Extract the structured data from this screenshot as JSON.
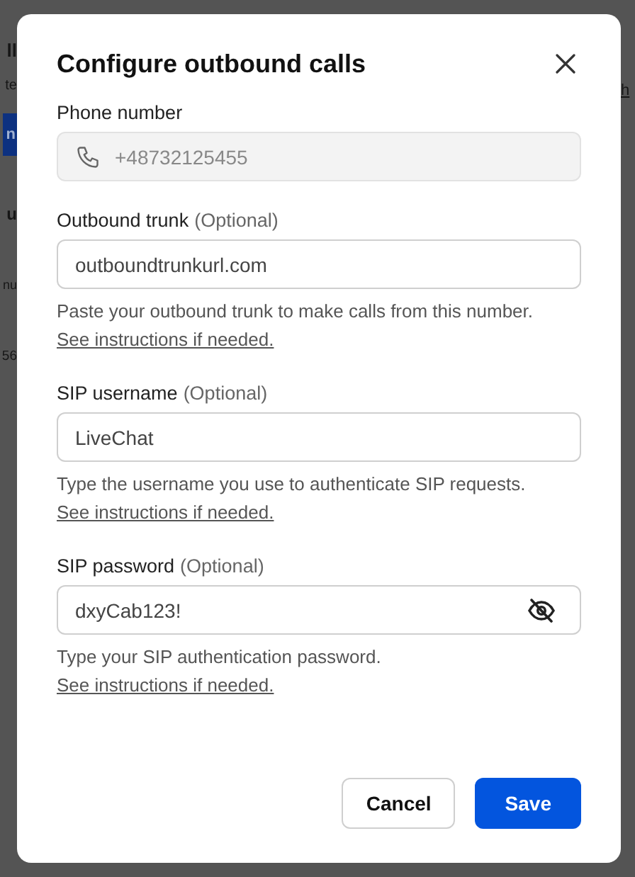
{
  "background": {
    "title": "ll",
    "subtitle": "te",
    "button": "n",
    "section_heading": "u",
    "column_header": "nu",
    "row_cell": "56",
    "link": "h"
  },
  "dialog": {
    "title": "Configure outbound calls",
    "fields": [
      {
        "kind": "phone",
        "label": "Phone number",
        "value": "+48732125455",
        "disabled": true
      },
      {
        "kind": "text",
        "label": "Outbound trunk",
        "optional": "(Optional)",
        "value": "outboundtrunkurl.com",
        "disabled": false,
        "help": "Paste your outbound trunk to make calls from this number.",
        "help_link": "See instructions if needed."
      },
      {
        "kind": "text",
        "label": "SIP username",
        "optional": "(Optional)",
        "value": "LiveChat",
        "disabled": false,
        "help": "Type the username you use to authenticate SIP requests.",
        "help_link": "See instructions if needed."
      },
      {
        "kind": "password",
        "label": "SIP password",
        "optional": "(Optional)",
        "value": "dxyCab123!",
        "disabled": false,
        "help": "Type your SIP authentication password.",
        "help_link": "See instructions if needed."
      }
    ],
    "buttons": [
      {
        "kind": "secondary",
        "label": "Cancel"
      },
      {
        "kind": "primary",
        "label": "Save"
      }
    ]
  }
}
